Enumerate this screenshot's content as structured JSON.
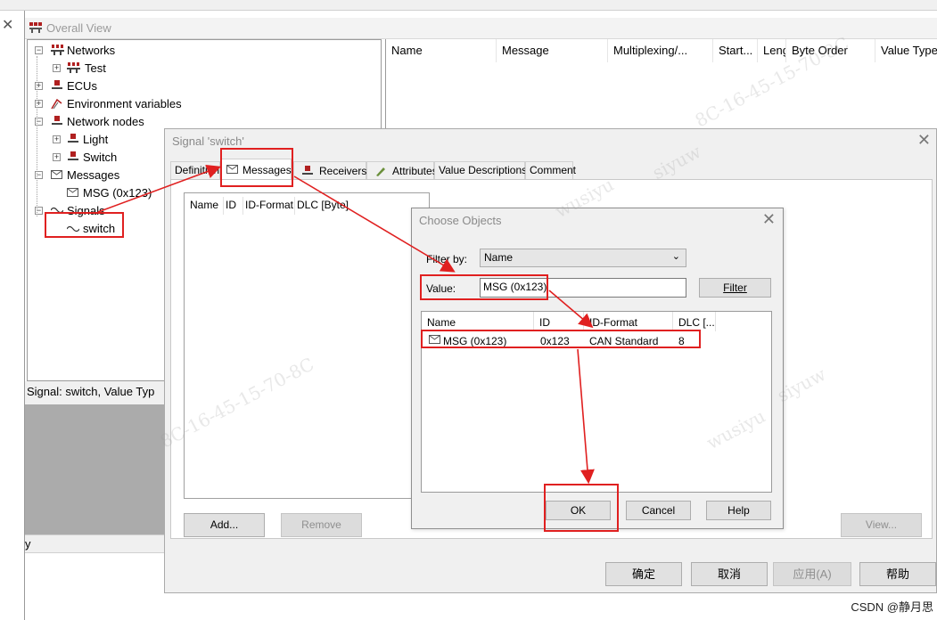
{
  "overall_view": {
    "title": "Overall View",
    "columns": [
      "Name",
      "Message",
      "Multiplexing/...",
      "Start...",
      "Leng...",
      "Byte Order",
      "Value Type"
    ],
    "tree": {
      "networks": "Networks",
      "test": "Test",
      "ecus": "ECUs",
      "env_vars": "Environment variables",
      "network_nodes": "Network nodes",
      "light": "Light",
      "switch_node": "Switch",
      "messages": "Messages",
      "msg_item": "MSG (0x123)",
      "signals": "Signals",
      "switch_signal": "switch"
    },
    "status": "Signal: switch,     Value Typ",
    "bottom_text": "y"
  },
  "signal_dialog": {
    "title": "Signal 'switch'",
    "tabs": [
      "Definition",
      "Messages",
      "Receivers",
      "Attributes",
      "Value Descriptions",
      "Comment"
    ],
    "list_columns": [
      "Name",
      "ID",
      "ID-Format",
      "DLC [Byte]"
    ],
    "add_button": "Add...",
    "remove_button": "Remove",
    "view_button": "View...",
    "ok_button": "确定",
    "cancel_button": "取消",
    "apply_button": "应用(A)",
    "help_button": "帮助"
  },
  "choose_dialog": {
    "title": "Choose Objects",
    "filter_label": "Filter by:",
    "filter_value": "Name",
    "value_label": "Value:",
    "value_input": "MSG (0x123)",
    "filter_button": "Filter",
    "columns": [
      "Name",
      "ID",
      "ID-Format",
      "DLC [..."
    ],
    "row": {
      "name": "MSG (0x123)",
      "id": "0x123",
      "format": "CAN Standard",
      "dlc": "8"
    },
    "ok_button": "OK",
    "cancel_button": "Cancel",
    "help_button": "Help"
  },
  "watermark": {
    "texts": [
      "8C-16-45-15-70-8C",
      "wusiyu",
      "siyuw"
    ]
  },
  "credit": "CSDN @静月思",
  "colors": {
    "annotation_red": "#e02020",
    "dialog_bg": "#f0f0f0"
  }
}
